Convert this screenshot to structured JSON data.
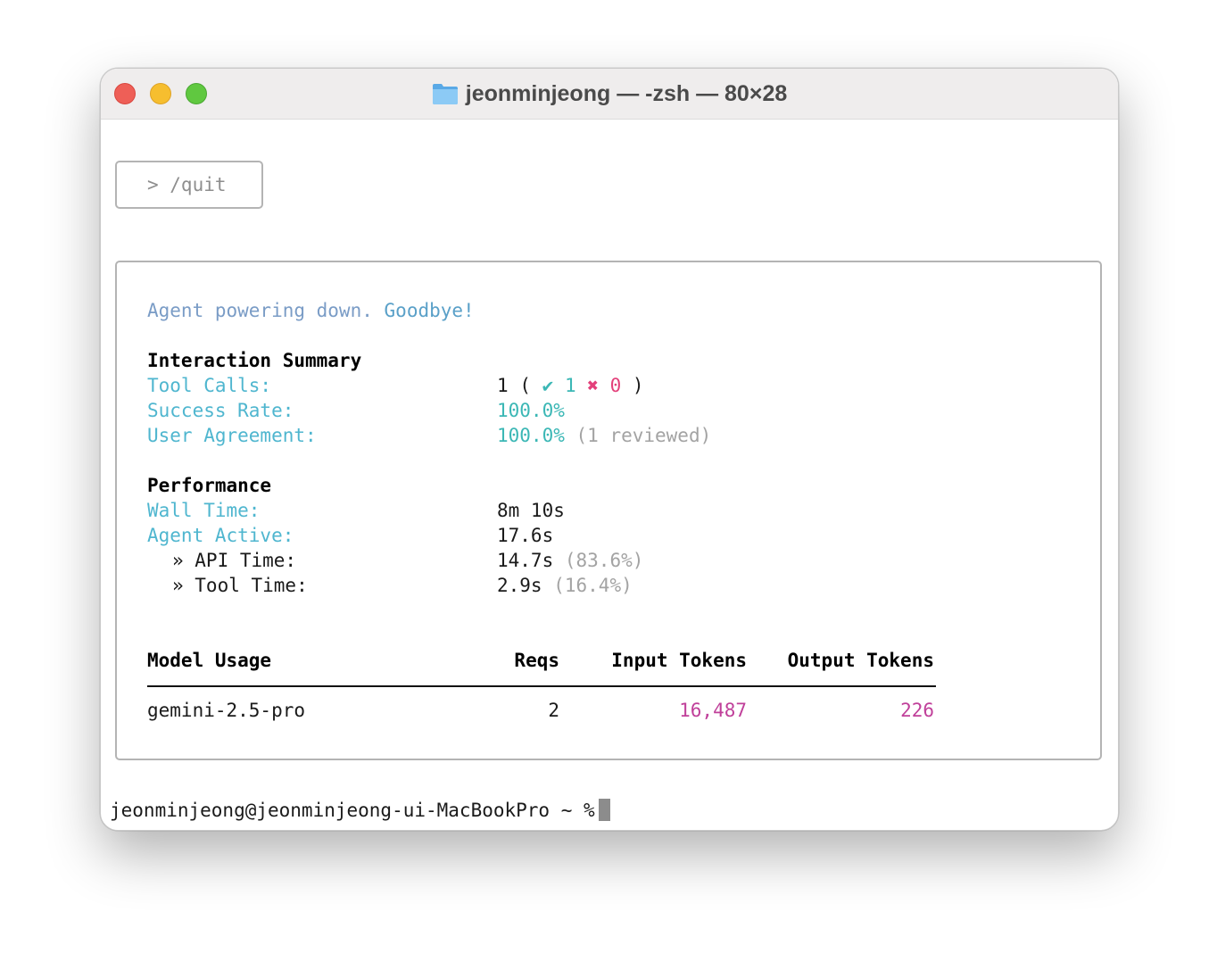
{
  "window": {
    "title": "jeonminjeong — -zsh — 80×28"
  },
  "input": {
    "command": "> /quit"
  },
  "summary": {
    "goodbye_part1": "Agent powering down.",
    "goodbye_part2": "Goodbye!",
    "interaction": {
      "heading": "Interaction Summary",
      "tool_calls_label": "Tool Calls:",
      "tool_calls_total": "1",
      "tool_calls_open": "(",
      "tool_calls_success_mark": "✔",
      "tool_calls_success": "1",
      "tool_calls_fail_mark": "✖",
      "tool_calls_fail": "0",
      "tool_calls_close": ")",
      "success_rate_label": "Success Rate:",
      "success_rate_value": "100.0%",
      "user_agreement_label": "User Agreement:",
      "user_agreement_value": "100.0%",
      "user_agreement_note": "(1 reviewed)"
    },
    "performance": {
      "heading": "Performance",
      "wall_time_label": "Wall Time:",
      "wall_time_value": "8m 10s",
      "agent_active_label": "Agent Active:",
      "agent_active_value": "17.6s",
      "api_time_label": "» API Time:",
      "api_time_value": "14.7s",
      "api_time_pct": "(83.6%)",
      "tool_time_label": "» Tool Time:",
      "tool_time_value": "2.9s",
      "tool_time_pct": "(16.4%)"
    },
    "model_usage": {
      "headers": {
        "model": "Model Usage",
        "reqs": "Reqs",
        "input_tokens": "Input Tokens",
        "output_tokens": "Output Tokens"
      },
      "rows": [
        {
          "model": "gemini-2.5-pro",
          "reqs": "2",
          "input_tokens": "16,487",
          "output_tokens": "226"
        }
      ]
    }
  },
  "shell": {
    "prompt": "jeonminjeong@jeonminjeong-ui-MacBookPro ~ %"
  },
  "colors": {
    "label_cyan": "#4fb6cf",
    "value_teal": "#3bb7b5",
    "error_pink": "#e3407a",
    "token_magenta": "#c0409a",
    "dim_gray": "#a3a3a3"
  }
}
